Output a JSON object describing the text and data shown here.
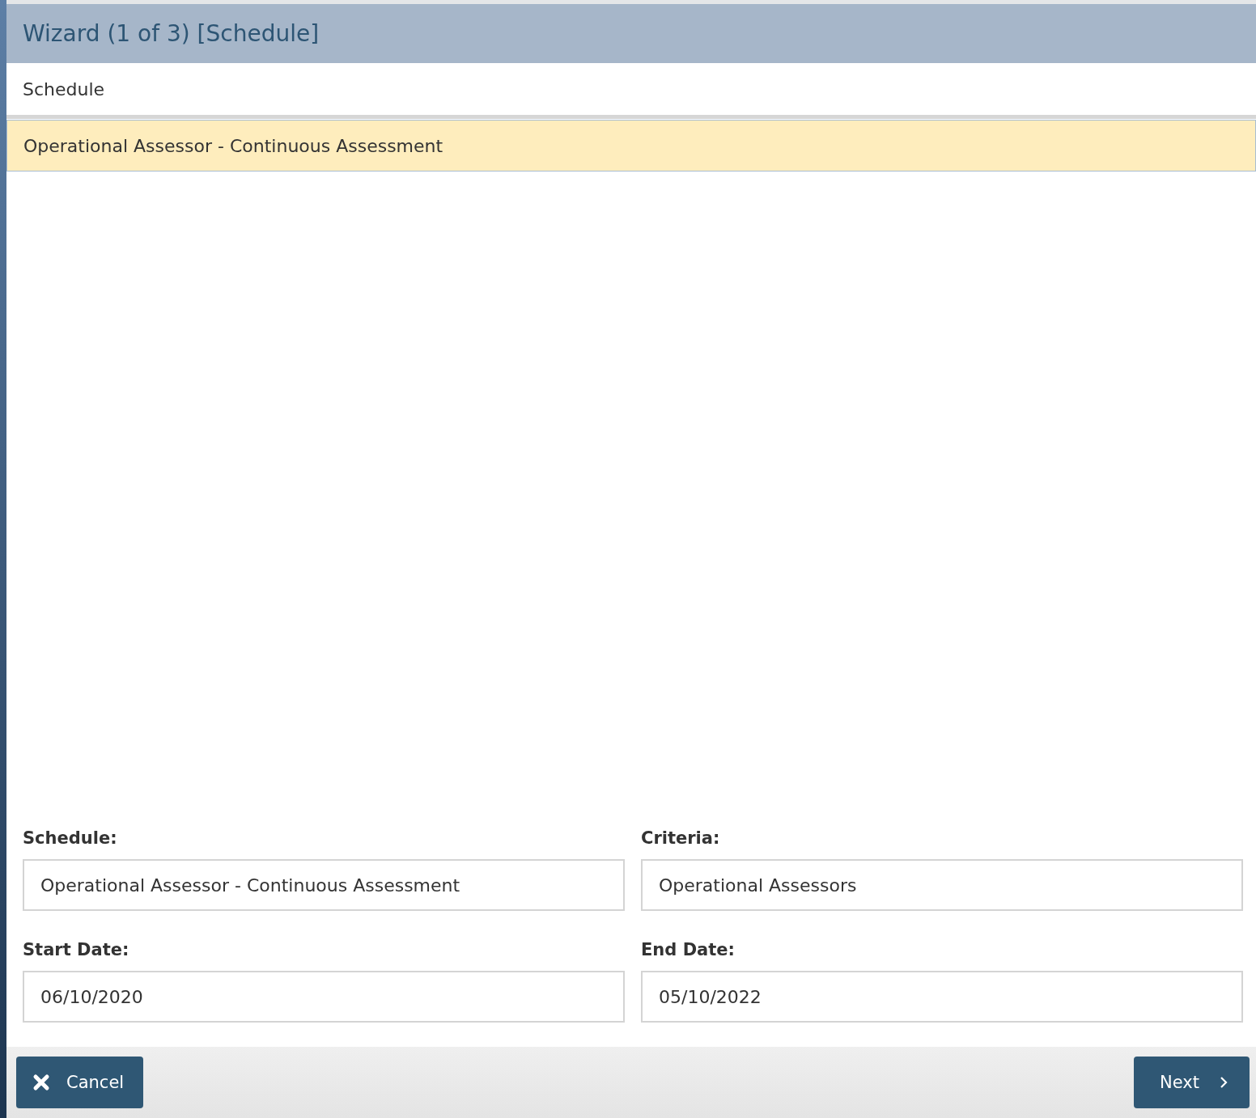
{
  "window": {
    "title": "Wizard (1 of 3) [Schedule]"
  },
  "list": {
    "column": "Schedule",
    "rows": [
      {
        "text": "Operational Assessor - Continuous Assessment",
        "selected": true
      }
    ]
  },
  "form": {
    "fields": [
      {
        "label": "Schedule:",
        "value": "Operational Assessor - Continuous Assessment"
      },
      {
        "label": "Criteria:",
        "value": "Operational Assessors"
      },
      {
        "label": "Start Date:",
        "value": "06/10/2020"
      },
      {
        "label": "End Date:",
        "value": "05/10/2022"
      }
    ]
  },
  "buttons": {
    "cancel": "Cancel",
    "next": "Next"
  }
}
